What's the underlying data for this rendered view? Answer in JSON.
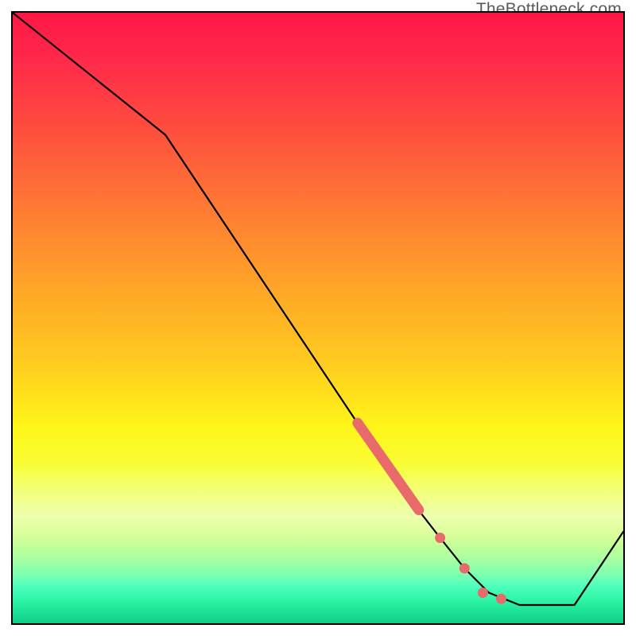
{
  "watermark": "TheBottleneck.com",
  "colors": {
    "curve": "#000000",
    "marker": "#e86a6a",
    "border": "#000000"
  },
  "chart_data": {
    "type": "line",
    "title": "",
    "xlabel": "",
    "ylabel": "",
    "xlim": [
      0,
      100
    ],
    "ylim": [
      0,
      100
    ],
    "grid": false,
    "legend": false,
    "x": [
      0,
      25,
      63,
      70,
      74,
      78,
      83,
      92,
      100
    ],
    "y": [
      100,
      80,
      23,
      14,
      9,
      5,
      3,
      3,
      15
    ],
    "highlight_segments": [
      {
        "x_start": 56,
        "x_end": 67,
        "style": "thick"
      }
    ],
    "highlight_points": [
      {
        "x": 70,
        "y": 14
      },
      {
        "x": 74,
        "y": 9
      },
      {
        "x": 77,
        "y": 5
      },
      {
        "x": 80,
        "y": 4
      }
    ],
    "description": "Single black curve descending from top-left to a minimum near x≈87 then rising toward the right edge, over a vertical heat gradient (red at top through yellow to green at bottom). Salmon-colored markers highlight a segment around x≈56–67 and a few points near the trough."
  }
}
